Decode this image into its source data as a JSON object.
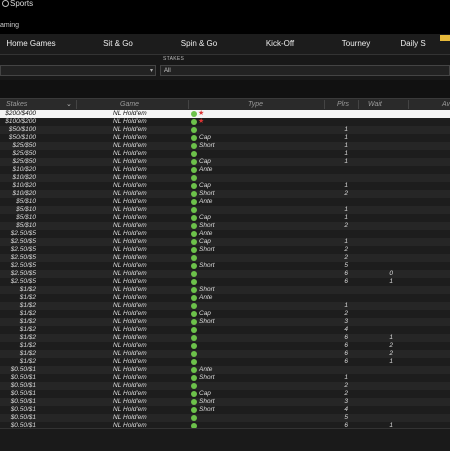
{
  "brand": {
    "name": "Sports",
    "sub": "aming"
  },
  "nav": [
    "Home Games",
    "Sit & Go",
    "Spin & Go",
    "Kick-Off",
    "Tourney",
    "Daily S"
  ],
  "filters": {
    "stakes_label": "STAKES",
    "stakes_value": "All"
  },
  "table": {
    "headers": {
      "stakes": "Stakes",
      "game": "Game",
      "type": "Type",
      "plrs": "Plrs",
      "wait": "Wait",
      "avg": "Av"
    },
    "rows": [
      {
        "stakes": "$200/$400",
        "game": "NL Hold'em",
        "type": "",
        "plrs": "",
        "wait": "",
        "star": true
      },
      {
        "stakes": "$100/$200",
        "game": "NL Hold'em",
        "type": "",
        "plrs": "",
        "wait": "",
        "star": true
      },
      {
        "stakes": "$50/$100",
        "game": "NL Hold'em",
        "type": "",
        "plrs": "1",
        "wait": ""
      },
      {
        "stakes": "$50/$100",
        "game": "NL Hold'em",
        "type": "Cap",
        "plrs": "1",
        "wait": ""
      },
      {
        "stakes": "$25/$50",
        "game": "NL Hold'em",
        "type": "Short",
        "plrs": "1",
        "wait": ""
      },
      {
        "stakes": "$25/$50",
        "game": "NL Hold'em",
        "type": "",
        "plrs": "1",
        "wait": ""
      },
      {
        "stakes": "$25/$50",
        "game": "NL Hold'em",
        "type": "Cap",
        "plrs": "1",
        "wait": ""
      },
      {
        "stakes": "$10/$20",
        "game": "NL Hold'em",
        "type": "Ante",
        "plrs": "",
        "wait": ""
      },
      {
        "stakes": "$10/$20",
        "game": "NL Hold'em",
        "type": "",
        "plrs": "",
        "wait": ""
      },
      {
        "stakes": "$10/$20",
        "game": "NL Hold'em",
        "type": "Cap",
        "plrs": "1",
        "wait": ""
      },
      {
        "stakes": "$10/$20",
        "game": "NL Hold'em",
        "type": "Short",
        "plrs": "2",
        "wait": ""
      },
      {
        "stakes": "$5/$10",
        "game": "NL Hold'em",
        "type": "Ante",
        "plrs": "",
        "wait": ""
      },
      {
        "stakes": "$5/$10",
        "game": "NL Hold'em",
        "type": "",
        "plrs": "1",
        "wait": ""
      },
      {
        "stakes": "$5/$10",
        "game": "NL Hold'em",
        "type": "Cap",
        "plrs": "1",
        "wait": ""
      },
      {
        "stakes": "$5/$10",
        "game": "NL Hold'em",
        "type": "Short",
        "plrs": "2",
        "wait": ""
      },
      {
        "stakes": "$2.50/$5",
        "game": "NL Hold'em",
        "type": "Ante",
        "plrs": "",
        "wait": ""
      },
      {
        "stakes": "$2.50/$5",
        "game": "NL Hold'em",
        "type": "Cap",
        "plrs": "1",
        "wait": ""
      },
      {
        "stakes": "$2.50/$5",
        "game": "NL Hold'em",
        "type": "Short",
        "plrs": "2",
        "wait": ""
      },
      {
        "stakes": "$2.50/$5",
        "game": "NL Hold'em",
        "type": "",
        "plrs": "2",
        "wait": ""
      },
      {
        "stakes": "$2.50/$5",
        "game": "NL Hold'em",
        "type": "Short",
        "plrs": "5",
        "wait": ""
      },
      {
        "stakes": "$2.50/$5",
        "game": "NL Hold'em",
        "type": "",
        "plrs": "6",
        "wait": "0"
      },
      {
        "stakes": "$2.50/$5",
        "game": "NL Hold'em",
        "type": "",
        "plrs": "6",
        "wait": "1"
      },
      {
        "stakes": "$1/$2",
        "game": "NL Hold'em",
        "type": "Short",
        "plrs": "",
        "wait": ""
      },
      {
        "stakes": "$1/$2",
        "game": "NL Hold'em",
        "type": "Ante",
        "plrs": "",
        "wait": ""
      },
      {
        "stakes": "$1/$2",
        "game": "NL Hold'em",
        "type": "",
        "plrs": "1",
        "wait": ""
      },
      {
        "stakes": "$1/$2",
        "game": "NL Hold'em",
        "type": "Cap",
        "plrs": "2",
        "wait": ""
      },
      {
        "stakes": "$1/$2",
        "game": "NL Hold'em",
        "type": "Short",
        "plrs": "3",
        "wait": ""
      },
      {
        "stakes": "$1/$2",
        "game": "NL Hold'em",
        "type": "",
        "plrs": "4",
        "wait": ""
      },
      {
        "stakes": "$1/$2",
        "game": "NL Hold'em",
        "type": "",
        "plrs": "6",
        "wait": "1"
      },
      {
        "stakes": "$1/$2",
        "game": "NL Hold'em",
        "type": "",
        "plrs": "6",
        "wait": "2"
      },
      {
        "stakes": "$1/$2",
        "game": "NL Hold'em",
        "type": "",
        "plrs": "6",
        "wait": "2"
      },
      {
        "stakes": "$1/$2",
        "game": "NL Hold'em",
        "type": "",
        "plrs": "6",
        "wait": "1"
      },
      {
        "stakes": "$0.50/$1",
        "game": "NL Hold'em",
        "type": "Ante",
        "plrs": "",
        "wait": ""
      },
      {
        "stakes": "$0.50/$1",
        "game": "NL Hold'em",
        "type": "Short",
        "plrs": "1",
        "wait": ""
      },
      {
        "stakes": "$0.50/$1",
        "game": "NL Hold'em",
        "type": "",
        "plrs": "2",
        "wait": ""
      },
      {
        "stakes": "$0.50/$1",
        "game": "NL Hold'em",
        "type": "Cap",
        "plrs": "2",
        "wait": ""
      },
      {
        "stakes": "$0.50/$1",
        "game": "NL Hold'em",
        "type": "Short",
        "plrs": "3",
        "wait": ""
      },
      {
        "stakes": "$0.50/$1",
        "game": "NL Hold'em",
        "type": "Short",
        "plrs": "4",
        "wait": ""
      },
      {
        "stakes": "$0.50/$1",
        "game": "NL Hold'em",
        "type": "",
        "plrs": "5",
        "wait": ""
      },
      {
        "stakes": "$0.50/$1",
        "game": "NL Hold'em",
        "type": "",
        "plrs": "6",
        "wait": "1"
      }
    ]
  },
  "colors": {
    "accent": "#6cc14a",
    "star": "#d33333",
    "badge": "#e6b93a"
  }
}
